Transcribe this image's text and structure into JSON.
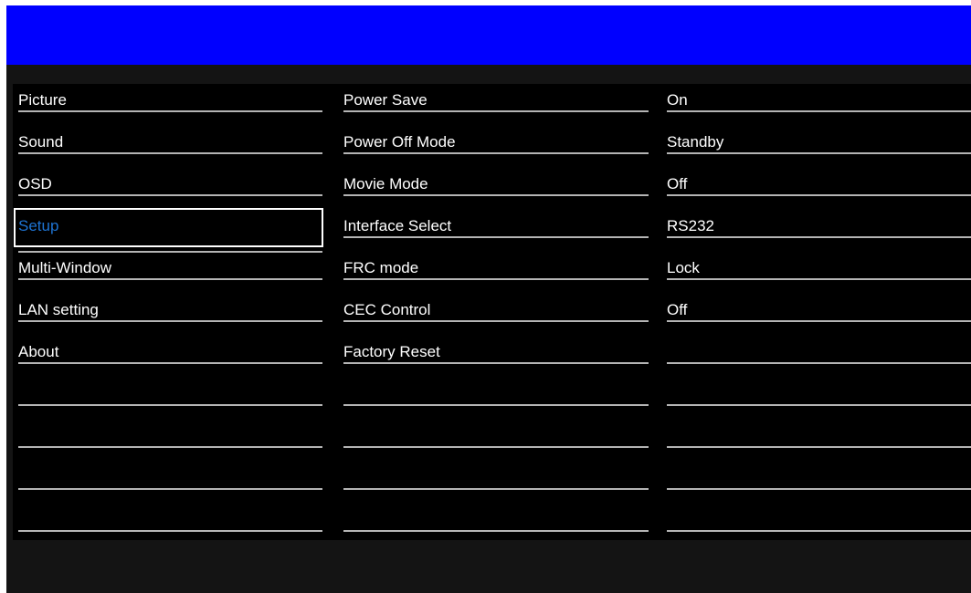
{
  "osd_menu": {
    "title": "",
    "categories": [
      {
        "label": "Picture"
      },
      {
        "label": "Sound"
      },
      {
        "label": "OSD"
      },
      {
        "label": "Setup",
        "selected": true
      },
      {
        "label": "Multi-Window"
      },
      {
        "label": "LAN setting"
      },
      {
        "label": "About"
      },
      {
        "label": ""
      },
      {
        "label": ""
      },
      {
        "label": ""
      },
      {
        "label": ""
      }
    ],
    "settings": [
      {
        "label": "Power Save",
        "value": "On"
      },
      {
        "label": "Power Off Mode",
        "value": "Standby"
      },
      {
        "label": "Movie Mode",
        "value": "Off"
      },
      {
        "label": "Interface Select",
        "value": "RS232"
      },
      {
        "label": "FRC mode",
        "value": "Lock"
      },
      {
        "label": "CEC Control",
        "value": "Off"
      },
      {
        "label": "Factory Reset",
        "value": ""
      },
      {
        "label": "",
        "value": ""
      },
      {
        "label": "",
        "value": ""
      },
      {
        "label": "",
        "value": ""
      },
      {
        "label": "",
        "value": ""
      }
    ],
    "colors": {
      "title_bar": "#0000ff",
      "background": "#000000",
      "text": "#ffffff",
      "selected_text": "#1e73d2",
      "divider": "#b4b4b4"
    }
  }
}
